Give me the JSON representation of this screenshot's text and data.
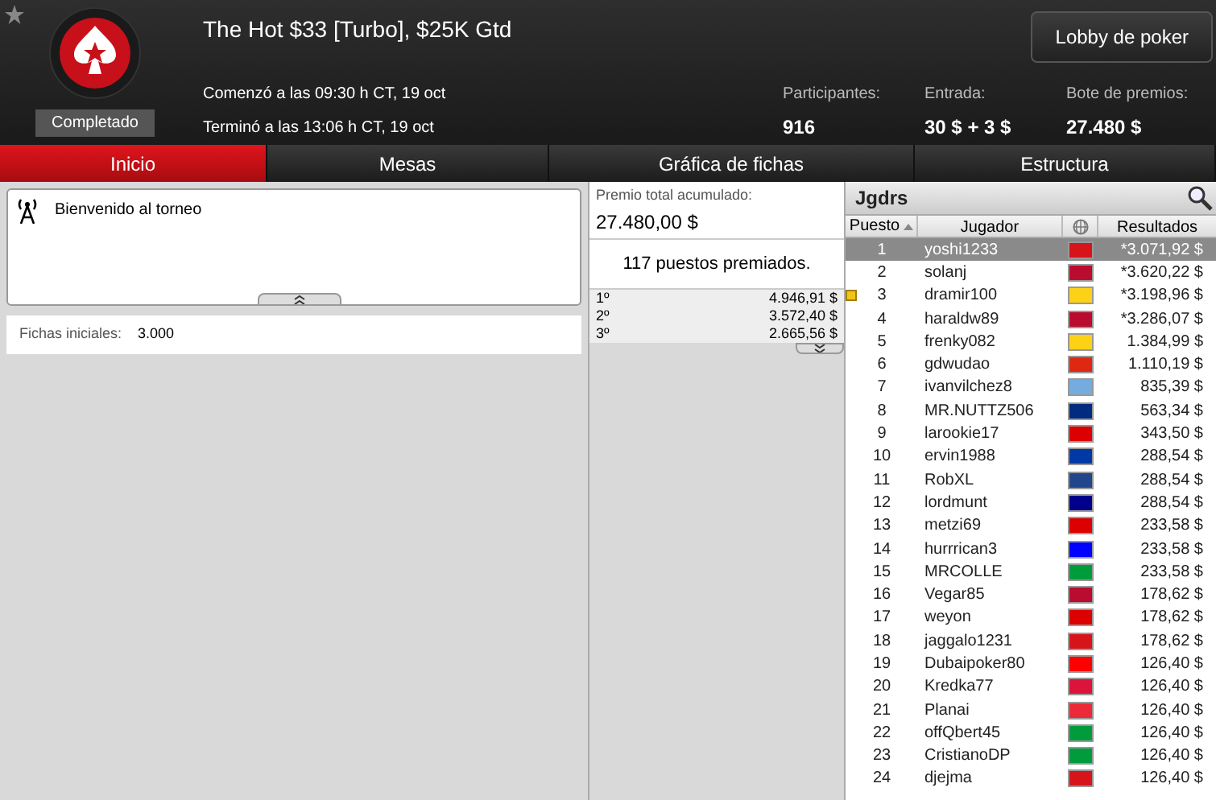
{
  "header": {
    "title": "The Hot $33 [Turbo], $25K Gtd",
    "status": "Completado",
    "started": "Comenzó a las 09:30 h CT, 19 oct",
    "ended": "Terminó a las 13:06 h CT, 19 oct",
    "lobby_button": "Lobby de poker",
    "stats": [
      {
        "label": "Participantes:",
        "value": "916"
      },
      {
        "label": "Entrada:",
        "value": "30 $ + 3 $"
      },
      {
        "label": "Bote de premios:",
        "value": "27.480 $"
      }
    ]
  },
  "tabs": [
    {
      "label": "Inicio",
      "selected": true
    },
    {
      "label": "Mesas",
      "selected": false
    },
    {
      "label": "Gráfica de fichas",
      "selected": false
    },
    {
      "label": "Estructura",
      "selected": false
    }
  ],
  "messages": {
    "text": "Bienvenido al torneo"
  },
  "info": {
    "label": "Fichas iniciales:",
    "value": "3.000"
  },
  "prizes": {
    "label": "Premio total acumulado:",
    "total": "27.480,00 $",
    "paid": "117 puestos premiados.",
    "rows": [
      {
        "place": "1º",
        "amount": "4.946,91 $"
      },
      {
        "place": "2º",
        "amount": "3.572,40 $"
      },
      {
        "place": "3º",
        "amount": "2.665,56 $"
      }
    ]
  },
  "players": {
    "title": "Jgdrs",
    "columns": [
      "Puesto",
      "Jugador",
      "Resultados"
    ],
    "rows": [
      {
        "rank": "1",
        "name": "yoshi1233",
        "result": "*3.071,92 $",
        "color": "#d7141a",
        "selected": true,
        "marked": false
      },
      {
        "rank": "2",
        "name": "solanj",
        "result": "*3.620,22 $",
        "color": "#ba0c2f",
        "selected": false,
        "marked": false
      },
      {
        "rank": "3",
        "name": "dramir100",
        "result": "*3.198,96 $",
        "color": "#fcd116",
        "selected": false,
        "marked": true
      },
      {
        "rank": "4",
        "name": "haraldw89",
        "result": "*3.286,07 $",
        "color": "#ba0c2f",
        "selected": false,
        "marked": false
      },
      {
        "rank": "5",
        "name": "frenky082",
        "result": "1.384,99 $",
        "color": "#fcd116",
        "selected": false,
        "marked": false
      },
      {
        "rank": "6",
        "name": "gdwudao",
        "result": "1.110,19 $",
        "color": "#de2910",
        "selected": false,
        "marked": false
      },
      {
        "rank": "7",
        "name": "ivanvilchez8",
        "result": "835,39 $",
        "color": "#74acdf",
        "selected": false,
        "marked": false
      },
      {
        "rank": "8",
        "name": "MR.NUTTZ506",
        "result": "563,34 $",
        "color": "#002b7f",
        "selected": false,
        "marked": false
      },
      {
        "rank": "9",
        "name": "larookie17",
        "result": "343,50 $",
        "color": "#dd0000",
        "selected": false,
        "marked": false
      },
      {
        "rank": "10",
        "name": "ervin1988",
        "result": "288,54 $",
        "color": "#0039a6",
        "selected": false,
        "marked": false
      },
      {
        "rank": "11",
        "name": "RobXL",
        "result": "288,54 $",
        "color": "#21468b",
        "selected": false,
        "marked": false
      },
      {
        "rank": "12",
        "name": "lordmunt",
        "result": "288,54 $",
        "color": "#00008b",
        "selected": false,
        "marked": false
      },
      {
        "rank": "13",
        "name": "metzi69",
        "result": "233,58 $",
        "color": "#dd0000",
        "selected": false,
        "marked": false
      },
      {
        "rank": "14",
        "name": "hurrrican3",
        "result": "233,58 $",
        "color": "#0000ff",
        "selected": false,
        "marked": false
      },
      {
        "rank": "15",
        "name": "MRCOLLE",
        "result": "233,58 $",
        "color": "#009c3b",
        "selected": false,
        "marked": false
      },
      {
        "rank": "16",
        "name": "Vegar85",
        "result": "178,62 $",
        "color": "#ba0c2f",
        "selected": false,
        "marked": false
      },
      {
        "rank": "17",
        "name": "weyon",
        "result": "178,62 $",
        "color": "#dd0000",
        "selected": false,
        "marked": false
      },
      {
        "rank": "18",
        "name": "jaggalo1231",
        "result": "178,62 $",
        "color": "#d7141a",
        "selected": false,
        "marked": false
      },
      {
        "rank": "19",
        "name": "Dubaipoker80",
        "result": "126,40 $",
        "color": "#ff0000",
        "selected": false,
        "marked": false
      },
      {
        "rank": "20",
        "name": "Kredka77",
        "result": "126,40 $",
        "color": "#dc143c",
        "selected": false,
        "marked": false
      },
      {
        "rank": "21",
        "name": "Planai",
        "result": "126,40 $",
        "color": "#ed2939",
        "selected": false,
        "marked": false
      },
      {
        "rank": "22",
        "name": "offQbert45",
        "result": "126,40 $",
        "color": "#009c3b",
        "selected": false,
        "marked": false
      },
      {
        "rank": "23",
        "name": "CristianoDP",
        "result": "126,40 $",
        "color": "#009c3b",
        "selected": false,
        "marked": false
      },
      {
        "rank": "24",
        "name": "djejma",
        "result": "126,40 $",
        "color": "#d7141a",
        "selected": false,
        "marked": false
      }
    ]
  }
}
